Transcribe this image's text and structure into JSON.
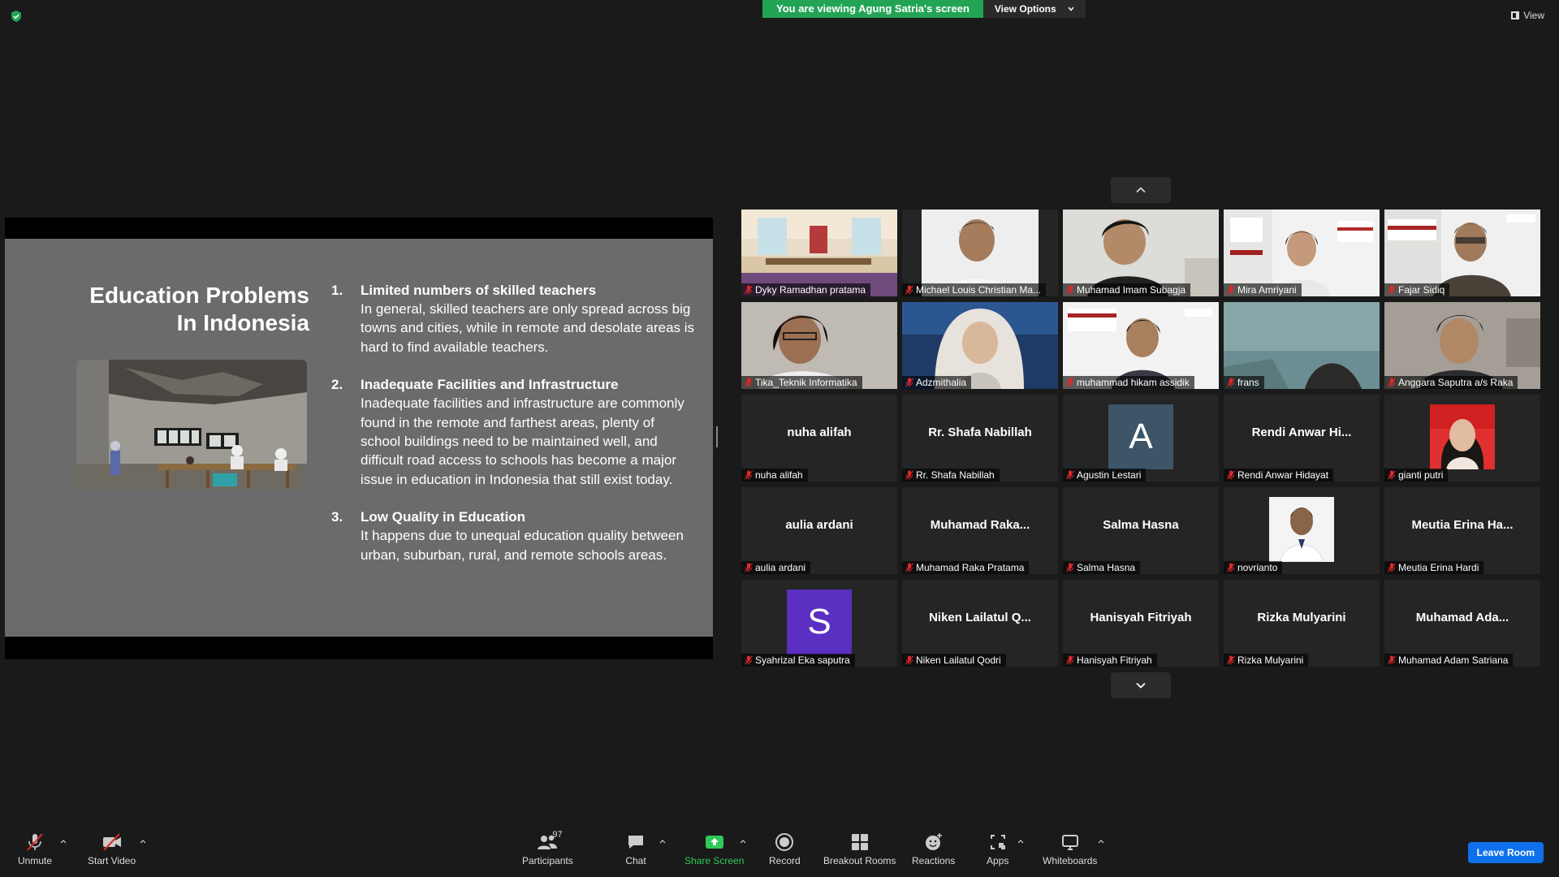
{
  "top": {
    "share_banner": "You are viewing Agung Satria's screen",
    "view_options": "View Options",
    "view": "View"
  },
  "slide": {
    "title_line1": "Education Problems",
    "title_line2": "In Indonesia",
    "items": [
      {
        "num": "1.",
        "heading": "Limited numbers of skilled teachers",
        "text": "In general, skilled teachers are only spread across big towns and cities, while in remote and desolate areas is hard to find available teachers."
      },
      {
        "num": "2.",
        "heading": "Inadequate Facilities and Infrastructure",
        "text": "Inadequate facilities and infrastructure are commonly found in the remote and farthest areas, plenty of school buildings need to be maintained well, and difficult road access to schools has become a major issue in education in Indonesia that still exist today."
      },
      {
        "num": "3.",
        "heading": "Low Quality in Education",
        "text": "It happens due to unequal education quality between urban, suburban, rural, and remote schools areas."
      }
    ]
  },
  "participants": [
    {
      "name": "Dyky Ramadhan pratama"
    },
    {
      "name": "Michael Louis Christian Ma..."
    },
    {
      "name": "Muhamad Imam Subagja"
    },
    {
      "name": "Mira Amriyani"
    },
    {
      "name": "Fajar Sidiq"
    },
    {
      "name": "Tika_Teknik Informatika"
    },
    {
      "name": "Adzmithalia"
    },
    {
      "name": "muhammad hikam assidik"
    },
    {
      "name": "frans"
    },
    {
      "name": "Anggara Saputra a/s Raka"
    },
    {
      "name": "nuha alifah",
      "center": "nuha alifah"
    },
    {
      "name": "Rr. Shafa Nabillah",
      "center": "Rr. Shafa Nabillah"
    },
    {
      "name": "Agustin Lestari",
      "letter": "A"
    },
    {
      "name": "Rendi Anwar Hidayat",
      "center": "Rendi  Anwar  Hi..."
    },
    {
      "name": "gianti putri"
    },
    {
      "name": "aulia ardani",
      "center": "aulia ardani"
    },
    {
      "name": "Muhamad Raka Pratama",
      "center": "Muhamad  Raka..."
    },
    {
      "name": "Salma Hasna",
      "center": "Salma Hasna"
    },
    {
      "name": "novrianto"
    },
    {
      "name": "Meutia Erina Hardi",
      "center": "Meutia  Erina  Ha..."
    },
    {
      "name": "Syahrizal Eka saputra",
      "letter": "S"
    },
    {
      "name": "Niken Lailatul Qodri",
      "center": "Niken  Lailatul  Q..."
    },
    {
      "name": "Hanisyah Fitriyah",
      "center": "Hanisyah Fitriyah"
    },
    {
      "name": "Rizka Mulyarini",
      "center": "Rizka Mulyarini"
    },
    {
      "name": "Muhamad Adam Satriana",
      "center": "Muhamad  Ada..."
    }
  ],
  "toolbar": {
    "unmute": "Unmute",
    "start_video": "Start Video",
    "participants": "Participants",
    "participants_count": "97",
    "chat": "Chat",
    "share_screen": "Share Screen",
    "record": "Record",
    "breakout_rooms": "Breakout Rooms",
    "reactions": "Reactions",
    "apps": "Apps",
    "whiteboards": "Whiteboards",
    "leave_room": "Leave Room"
  },
  "colors": {
    "share_green": "#23a455",
    "leave_blue": "#0e71eb",
    "muted_red": "#e02828",
    "avatar_a": "#3d5566",
    "avatar_s": "#5a2fc2"
  }
}
